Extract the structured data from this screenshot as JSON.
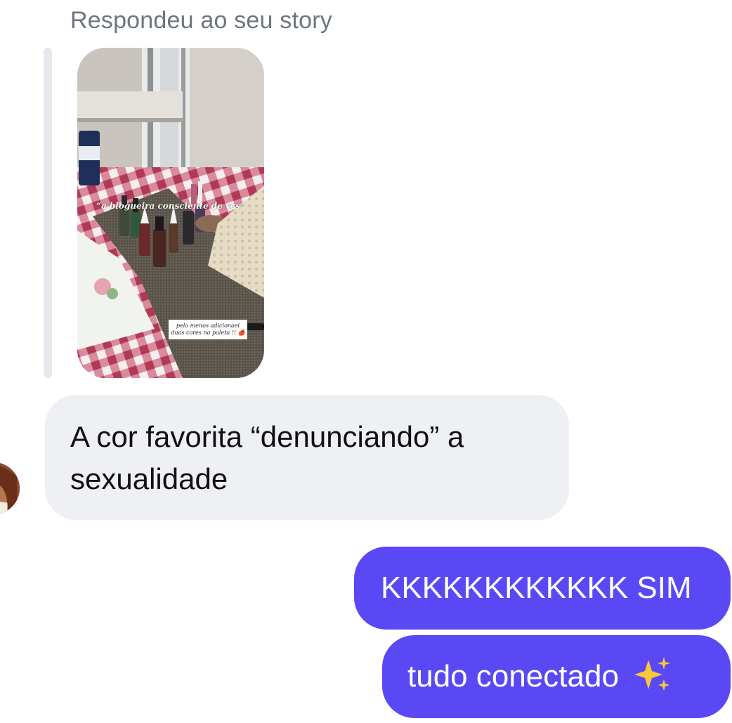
{
  "story_reply": {
    "label": "Respondeu ao seu story",
    "story_caption_top": "“a blogueira consciente de vcs”",
    "story_caption_bottom": "pelo menos adicionaei duas cores na paleta !! 🍎"
  },
  "messages": [
    {
      "sender": "contact",
      "text": "A cor favorita “denunciando” a sexualidade"
    },
    {
      "sender": "me",
      "text": "KKKKKKKKKKKK SIM"
    },
    {
      "sender": "me",
      "text": "tudo conectado",
      "emoji": "sparkles-icon"
    }
  ],
  "colors": {
    "outgoing_bubble": "#5b48f5",
    "incoming_bubble": "#eef0f4",
    "label_gray": "#6e7580"
  }
}
